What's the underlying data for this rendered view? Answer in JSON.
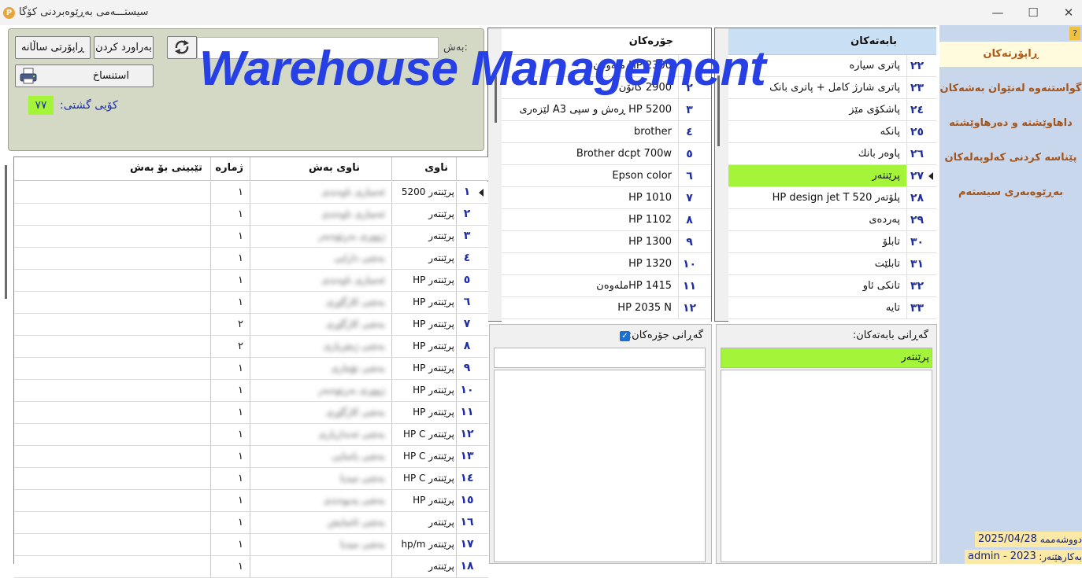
{
  "window": {
    "title": "سیستـــەمی بەڕێوەبردنی کۆگا",
    "app_icon": "P",
    "minimize_glyph": "—",
    "maximize_glyph": "☐",
    "close_glyph": "✕"
  },
  "nav": {
    "help": "?",
    "reports": "ڕاپۆرتەکان",
    "items": [
      "گواستنەوە لەنێوان بەشەکان",
      "داهاوێشتە و دەرهاوێشتە",
      "پێناسە کردنی کەلوپەلەکان",
      "بەڕێوەبەری سیستەم"
    ],
    "date_label": "دووشەممە",
    "date": "2025/04/28",
    "user_label": "بەکارهێنەر:",
    "user": "admin - 2023"
  },
  "search_panel": {
    "section_label": "بەش:",
    "section_value": "",
    "annual_report_button": "ڕاپۆرتی ساڵانە",
    "compare_button": "بەراورد کردن",
    "copy_button": "استنساخ",
    "total_label": "کۆیی گشتی:",
    "total_value": "٧٧"
  },
  "watermark": "Warehouse Management",
  "types_grid": {
    "header": "جۆرەکان",
    "rows": [
      {
        "num": "١",
        "name": "HP 2300 ملەوەن"
      },
      {
        "num": "٢",
        "name": "2900 کانۆن"
      },
      {
        "num": "٣",
        "name": "HP 5200 ڕەش و سپی A3 لێزەری"
      },
      {
        "num": "٤",
        "name": "brother"
      },
      {
        "num": "٥",
        "name": "Brother dcpt 700w"
      },
      {
        "num": "٦",
        "name": "Epson color"
      },
      {
        "num": "٧",
        "name": "HP 1010"
      },
      {
        "num": "٨",
        "name": "HP 1102"
      },
      {
        "num": "٩",
        "name": "HP 1300"
      },
      {
        "num": "١٠",
        "name": "HP 1320"
      },
      {
        "num": "١١",
        "name": "HP 1415ملەوەن"
      },
      {
        "num": "١٢",
        "name": "HP 2035 N"
      }
    ]
  },
  "categories_grid": {
    "header": "بابەتەکان",
    "rows": [
      {
        "num": "٢٢",
        "name": "پاتری سیارە"
      },
      {
        "num": "٢٣",
        "name": "پاتری شارژ کامل + پاتری بانک"
      },
      {
        "num": "٢٤",
        "name": "پاشکۆی مێز"
      },
      {
        "num": "٢٥",
        "name": "پانکە"
      },
      {
        "num": "٢٦",
        "name": "پاوەر بانك"
      },
      {
        "num": "٢٧",
        "name": "پرێنتەر",
        "selected": true
      },
      {
        "num": "٢٨",
        "name": "پلۆتەر HP design jet T 520"
      },
      {
        "num": "٢٩",
        "name": "پەردەی"
      },
      {
        "num": "٣٠",
        "name": "تابلۆ"
      },
      {
        "num": "٣١",
        "name": "تابلێت"
      },
      {
        "num": "٣٢",
        "name": "تانکی ئاو"
      },
      {
        "num": "٣٣",
        "name": "تایە"
      }
    ]
  },
  "types_filter": {
    "label": "گەڕانی جۆرەکان:",
    "checked": true,
    "value": ""
  },
  "categories_filter": {
    "label": "گەڕانی بابەتەکان:",
    "value": "پرێنتەر"
  },
  "main_table": {
    "headers": {
      "name": "ناوی",
      "section": "ناوی بەش",
      "count": "ژمارە",
      "note": "تێبینی بۆ بەش"
    },
    "rows": [
      {
        "num": "١",
        "name": "پرێنتەر 5200",
        "section": "ئەمباری ناوەندی",
        "count": "١"
      },
      {
        "num": "٢",
        "name": "پرێنتەر",
        "section": "ئەمباری ناوەندی",
        "count": "١"
      },
      {
        "num": "٣",
        "name": "پرێنتەر",
        "section": "ژووری بەڕێوەبەر",
        "count": "١"
      },
      {
        "num": "٤",
        "name": "پرێنتەر",
        "section": "بەشی دارایی",
        "count": "١"
      },
      {
        "num": "٥",
        "name": "پرێنتەر HP",
        "section": "ئەمباری ناوەندی",
        "count": "١"
      },
      {
        "num": "٦",
        "name": "پرێنتەر HP",
        "section": "بەشی کارگێڕی",
        "count": "١"
      },
      {
        "num": "٧",
        "name": "پرێنتەر HP",
        "section": "بەشی کارگێڕی",
        "count": "٢"
      },
      {
        "num": "٨",
        "name": "پرێنتەر HP",
        "section": "بەشی ژمێریاری",
        "count": "٢"
      },
      {
        "num": "٩",
        "name": "پرێنتەر HP",
        "section": "بەشی تۆماری",
        "count": "١"
      },
      {
        "num": "١٠",
        "name": "پرێنتەر HP",
        "section": "ژووری بەڕێوەبەر",
        "count": "١"
      },
      {
        "num": "١١",
        "name": "پرێنتەر HP",
        "section": "بەشی کارگێڕی",
        "count": "١"
      },
      {
        "num": "١٢",
        "name": "پرێنتەر HP C",
        "section": "بەشی ئەندازیاری",
        "count": "١"
      },
      {
        "num": "١٣",
        "name": "پرێنتەر HP C",
        "section": "بەشی یاسایی",
        "count": "١"
      },
      {
        "num": "١٤",
        "name": "پرێنتەر HP C",
        "section": "بەشی میدیا",
        "count": "١"
      },
      {
        "num": "١٥",
        "name": "پرێنتەر HP",
        "section": "بەشی پەیوەندی",
        "count": "١"
      },
      {
        "num": "١٦",
        "name": "پرێنتەر",
        "section": "بەشی ئاسایش",
        "count": "١"
      },
      {
        "num": "١٧",
        "name": "پرێنتەر hp/m",
        "section": "بەشی میدیا",
        "count": "١"
      },
      {
        "num": "١٨",
        "name": "پرێنتەر",
        "section": "",
        "count": "١"
      }
    ]
  }
}
